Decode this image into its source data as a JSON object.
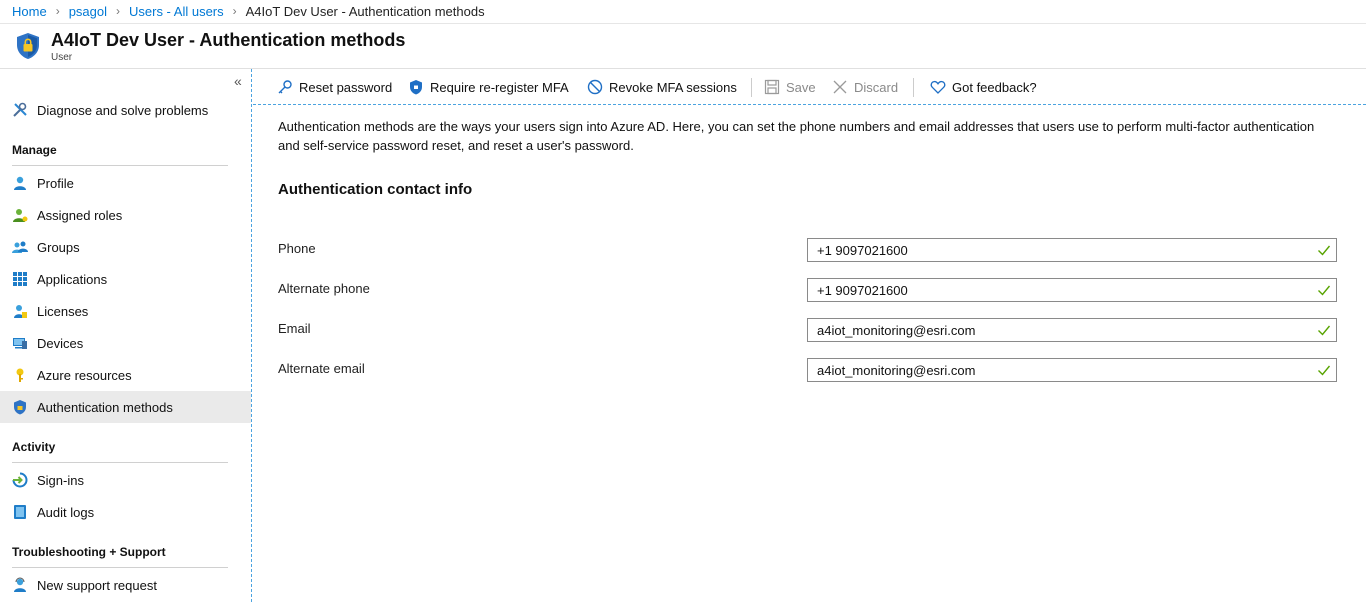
{
  "breadcrumb": {
    "items": [
      "Home",
      "psagol",
      "Users - All users"
    ],
    "current": "A4IoT Dev User - Authentication methods"
  },
  "header": {
    "title": "A4IoT Dev User - Authentication methods",
    "subtitle": "User"
  },
  "sidebar": {
    "collapse": "«",
    "top_item": "Diagnose and solve problems",
    "sections": {
      "manage": "Manage",
      "activity": "Activity",
      "troubleshooting": "Troubleshooting + Support"
    },
    "manage_items": [
      "Profile",
      "Assigned roles",
      "Groups",
      "Applications",
      "Licenses",
      "Devices",
      "Azure resources",
      "Authentication methods"
    ],
    "activity_items": [
      "Sign-ins",
      "Audit logs"
    ],
    "support_items": [
      "New support request"
    ]
  },
  "toolbar": {
    "reset_password": "Reset password",
    "require_reregister": "Require re-register MFA",
    "revoke_sessions": "Revoke MFA sessions",
    "save": "Save",
    "discard": "Discard",
    "feedback": "Got feedback?"
  },
  "content": {
    "description": "Authentication methods are the ways your users sign into Azure AD. Here, you can set the phone numbers and email addresses that users use to perform multi-factor authentication and self-service password reset, and reset a user's password.",
    "section_title": "Authentication contact info",
    "fields": [
      {
        "label": "Phone",
        "value": "+1 9097021600"
      },
      {
        "label": "Alternate phone",
        "value": "+1 9097021600"
      },
      {
        "label": "Email",
        "value": "a4iot_monitoring@esri.com"
      },
      {
        "label": "Alternate email",
        "value": "a4iot_monitoring@esri.com"
      }
    ]
  },
  "colors": {
    "link": "#0078d4",
    "valid_check": "#57a300",
    "active_nav": "#eaeaea"
  }
}
